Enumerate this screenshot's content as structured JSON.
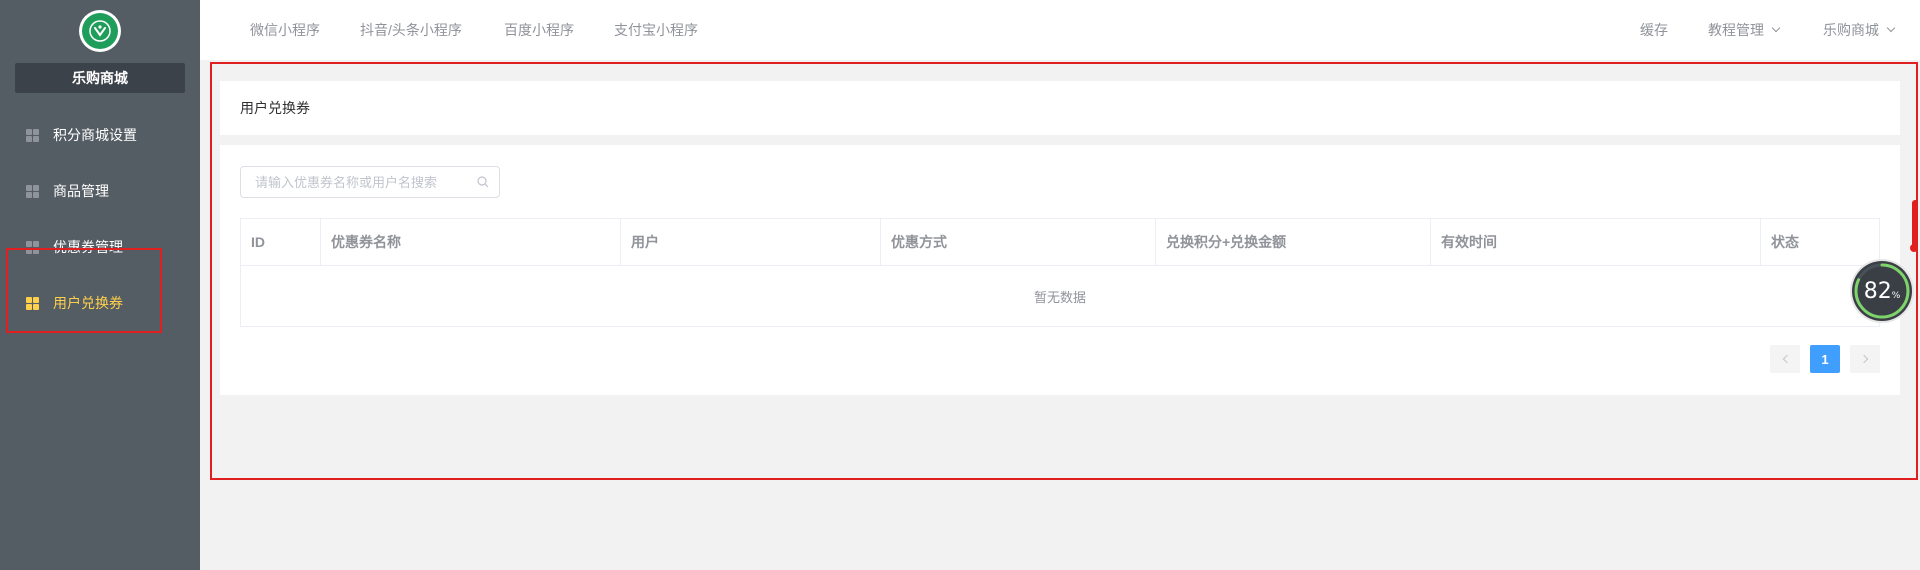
{
  "sidebar": {
    "shop_name": "乐购商城",
    "items": [
      {
        "label": "积分商城设置",
        "active": false
      },
      {
        "label": "商品管理",
        "active": false
      },
      {
        "label": "优惠券管理",
        "active": false
      },
      {
        "label": "用户兑换券",
        "active": true
      }
    ]
  },
  "header": {
    "tabs": [
      {
        "label": "微信小程序"
      },
      {
        "label": "抖音/头条小程序"
      },
      {
        "label": "百度小程序"
      },
      {
        "label": "支付宝小程序"
      }
    ],
    "right": {
      "cache": "缓存",
      "tutorial": "教程管理",
      "shop": "乐购商城"
    }
  },
  "page": {
    "title": "用户兑换券",
    "search_placeholder": "请输入优惠券名称或用户名搜索",
    "table": {
      "columns": [
        "ID",
        "优惠券名称",
        "用户",
        "优惠方式",
        "兑换积分+兑换金额",
        "有效时间",
        "状态"
      ],
      "empty_text": "暂无数据"
    },
    "pagination": {
      "current_page": "1"
    }
  },
  "widget": {
    "percent": "82",
    "unit": "%",
    "progress": 0.82
  },
  "colors": {
    "sidebar_bg": "#545c64",
    "active": "#ffd04b",
    "primary": "#409eff",
    "highlight": "#e02020"
  }
}
